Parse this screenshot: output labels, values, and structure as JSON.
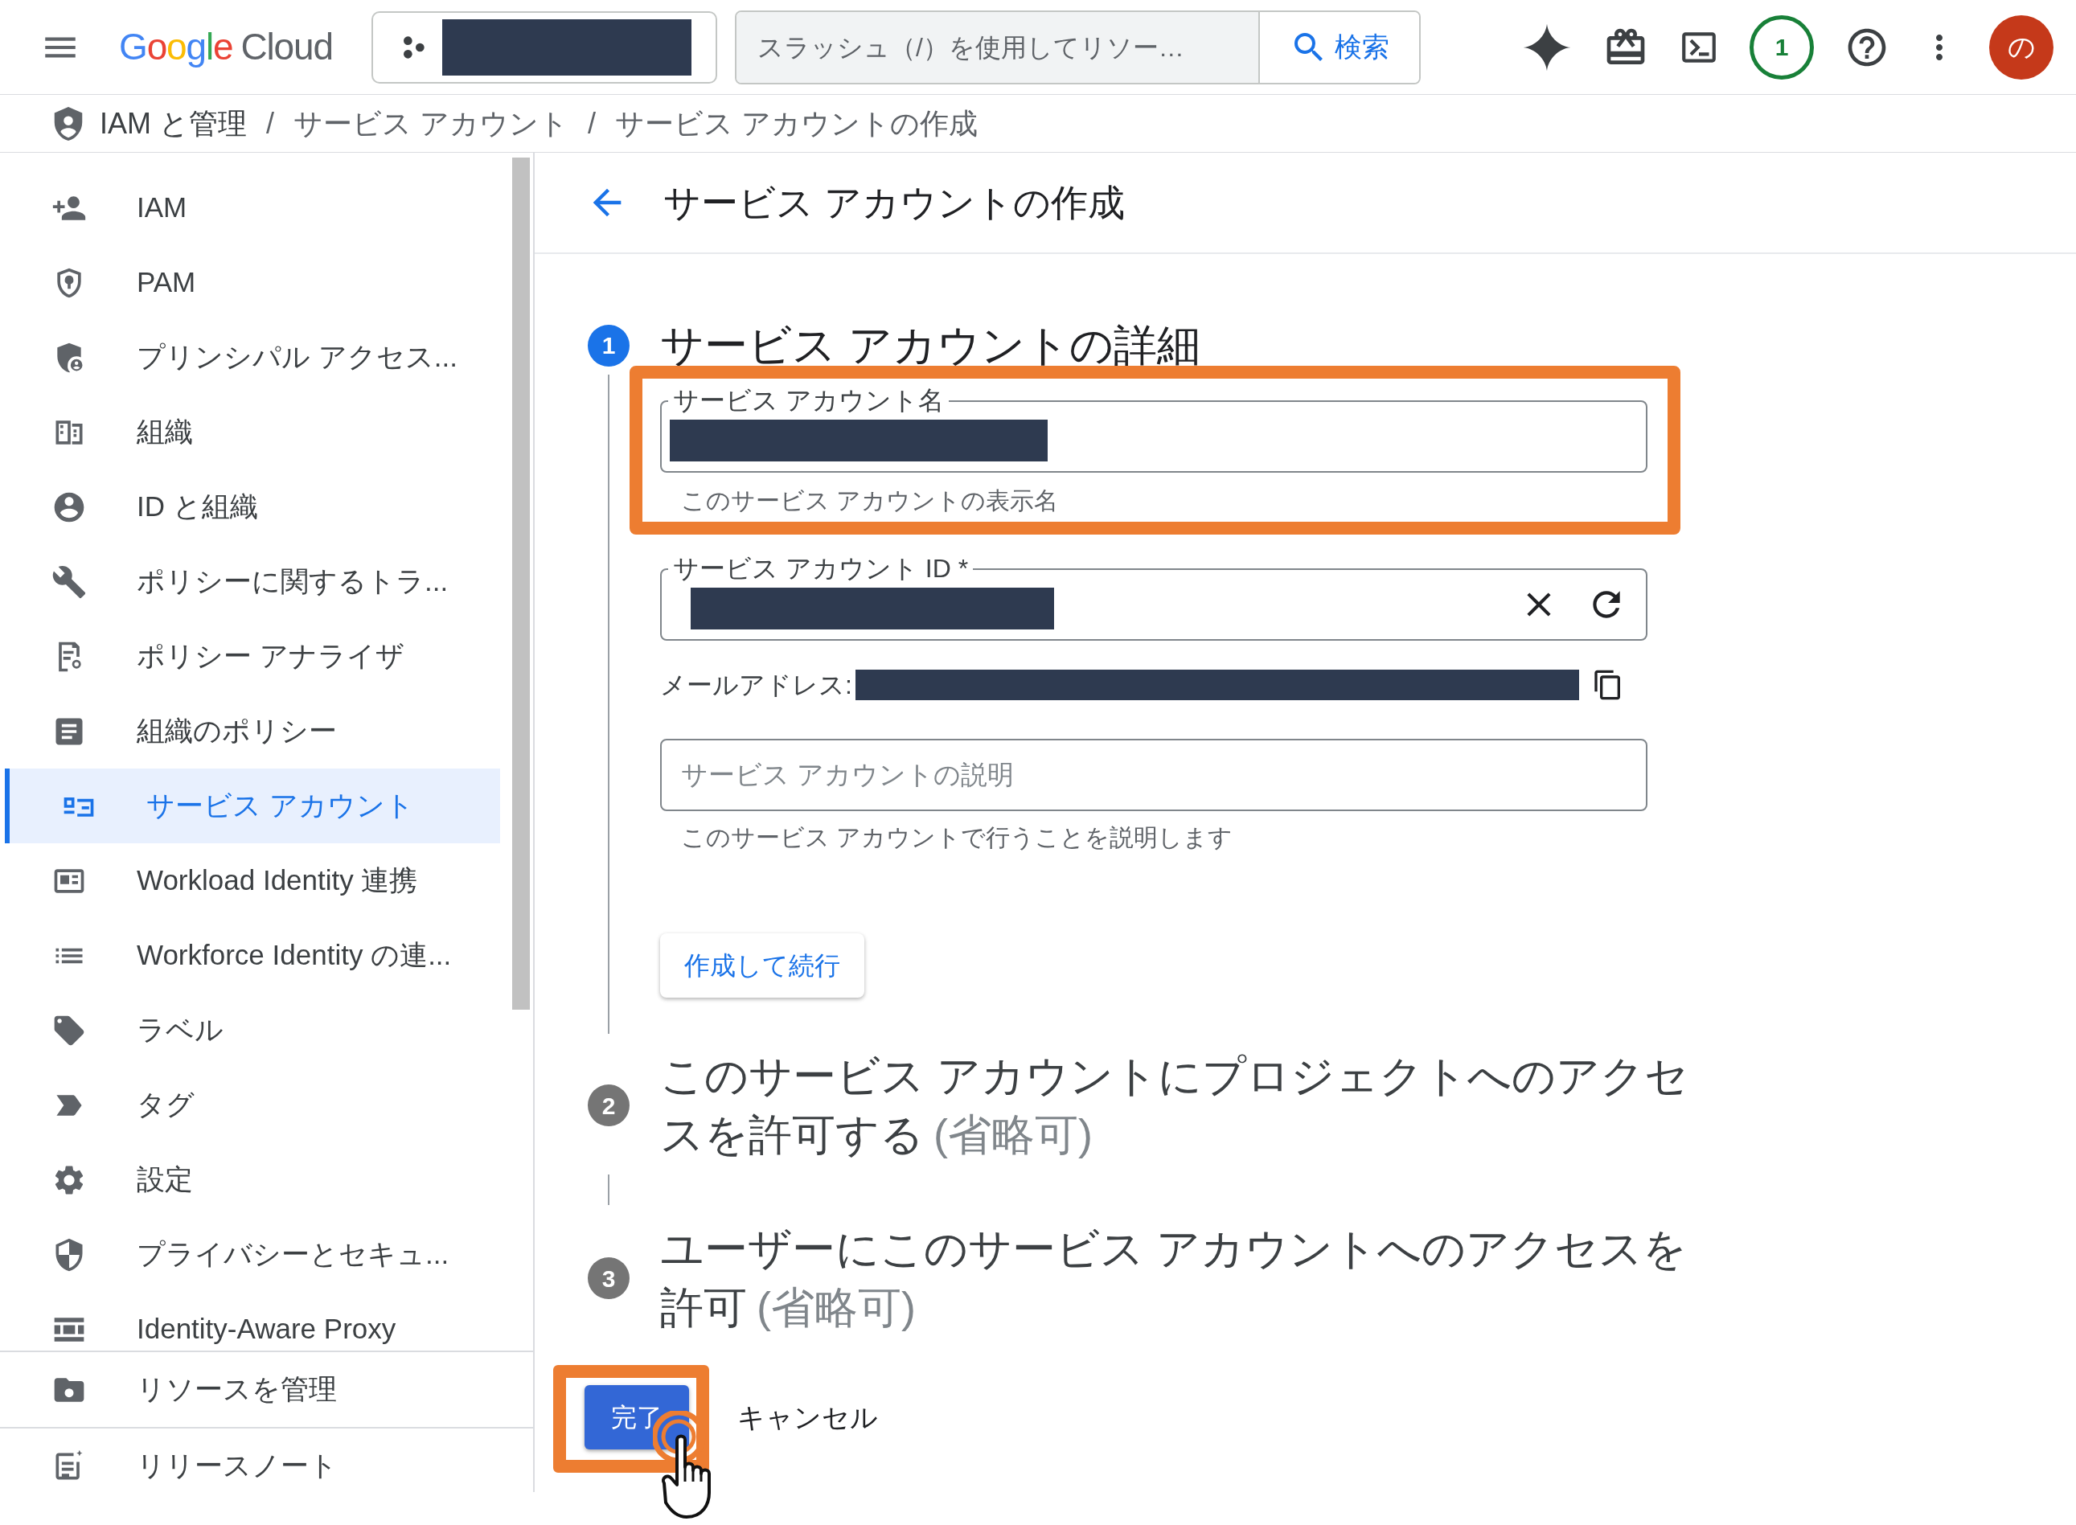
{
  "topbar": {
    "logo": {
      "brand": "Google",
      "product": "Cloud"
    },
    "search": {
      "placeholder": "スラッシュ（/）を使用してリソー…",
      "button": "検索"
    },
    "notifications": "1",
    "avatar": "の"
  },
  "breadcrumb": {
    "items": [
      "IAM と管理",
      "サービス アカウント",
      "サービス アカウントの作成"
    ],
    "separators": [
      "/",
      "/"
    ]
  },
  "sidebar": {
    "items": [
      {
        "label": "IAM",
        "selected": false
      },
      {
        "label": "PAM",
        "selected": false
      },
      {
        "label": "プリンシパル アクセス...",
        "selected": false
      },
      {
        "label": "組織",
        "selected": false
      },
      {
        "label": "ID と組織",
        "selected": false
      },
      {
        "label": "ポリシーに関するトラ...",
        "selected": false
      },
      {
        "label": "ポリシー アナライザ",
        "selected": false
      },
      {
        "label": "組織のポリシー",
        "selected": false
      },
      {
        "label": "サービス アカウント",
        "selected": true
      },
      {
        "label": "Workload Identity 連携",
        "selected": false
      },
      {
        "label": "Workforce Identity の連...",
        "selected": false
      },
      {
        "label": "ラベル",
        "selected": false
      },
      {
        "label": "タグ",
        "selected": false
      },
      {
        "label": "設定",
        "selected": false
      },
      {
        "label": "プライバシーとセキュ...",
        "selected": false
      },
      {
        "label": "Identity-Aware Proxy",
        "selected": false
      }
    ],
    "footer_items": [
      {
        "label": "リソースを管理",
        "selected": false
      },
      {
        "label": "リリースノート",
        "selected": false
      }
    ]
  },
  "page_title": "サービス アカウントの作成",
  "steps": [
    {
      "number": "1",
      "title": "サービス アカウントの詳細",
      "active": true
    },
    {
      "number": "2",
      "title": "このサービス アカウントにプロジェクトへのアクセスを許可する",
      "note": "(省略可)",
      "active": false
    },
    {
      "number": "3",
      "title": "ユーザーにこのサービス アカウントへのアクセスを許可",
      "note": "(省略可)",
      "active": false
    }
  ],
  "form": {
    "name_field": {
      "label": "サービス アカウント名",
      "helper": "このサービス アカウントの表示名"
    },
    "id_field": {
      "label": "サービス アカウント ID *"
    },
    "email_label": "メールアドレス:",
    "description_field": {
      "placeholder": "サービス アカウントの説明",
      "helper": "このサービス アカウントで行うことを説明します"
    },
    "continue_button": "作成して続行"
  },
  "actions": {
    "done": "完了",
    "cancel": "キャンセル"
  }
}
